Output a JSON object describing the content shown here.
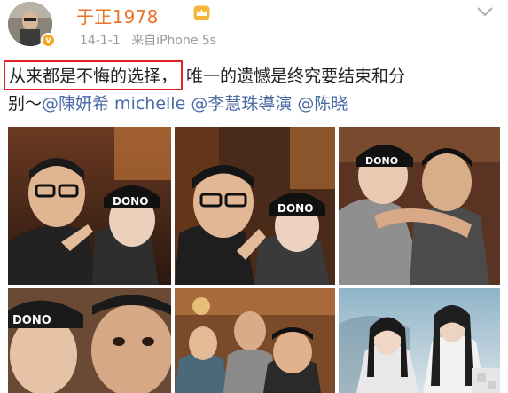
{
  "post": {
    "author": "于正1978",
    "time": "14-1-1",
    "source": "来自iPhone 5s",
    "verified_badge": "v",
    "line1_highlight": "从来都是不悔的选择，",
    "line1_rest": "唯一的遗憾是终究要结束和分",
    "line2_start": "别～",
    "mentions": [
      "@陳妍希 michelle",
      "@李慧珠導演",
      "@陈晓"
    ],
    "cap_text": "DONO"
  },
  "icons": {
    "author_badge": "crown-icon",
    "menu": "chevron-down-icon"
  },
  "colors": {
    "username": "#e8752a",
    "mention": "#4a6aa5",
    "highlight_box": "#e2232a",
    "meta": "#9a9a9a"
  }
}
